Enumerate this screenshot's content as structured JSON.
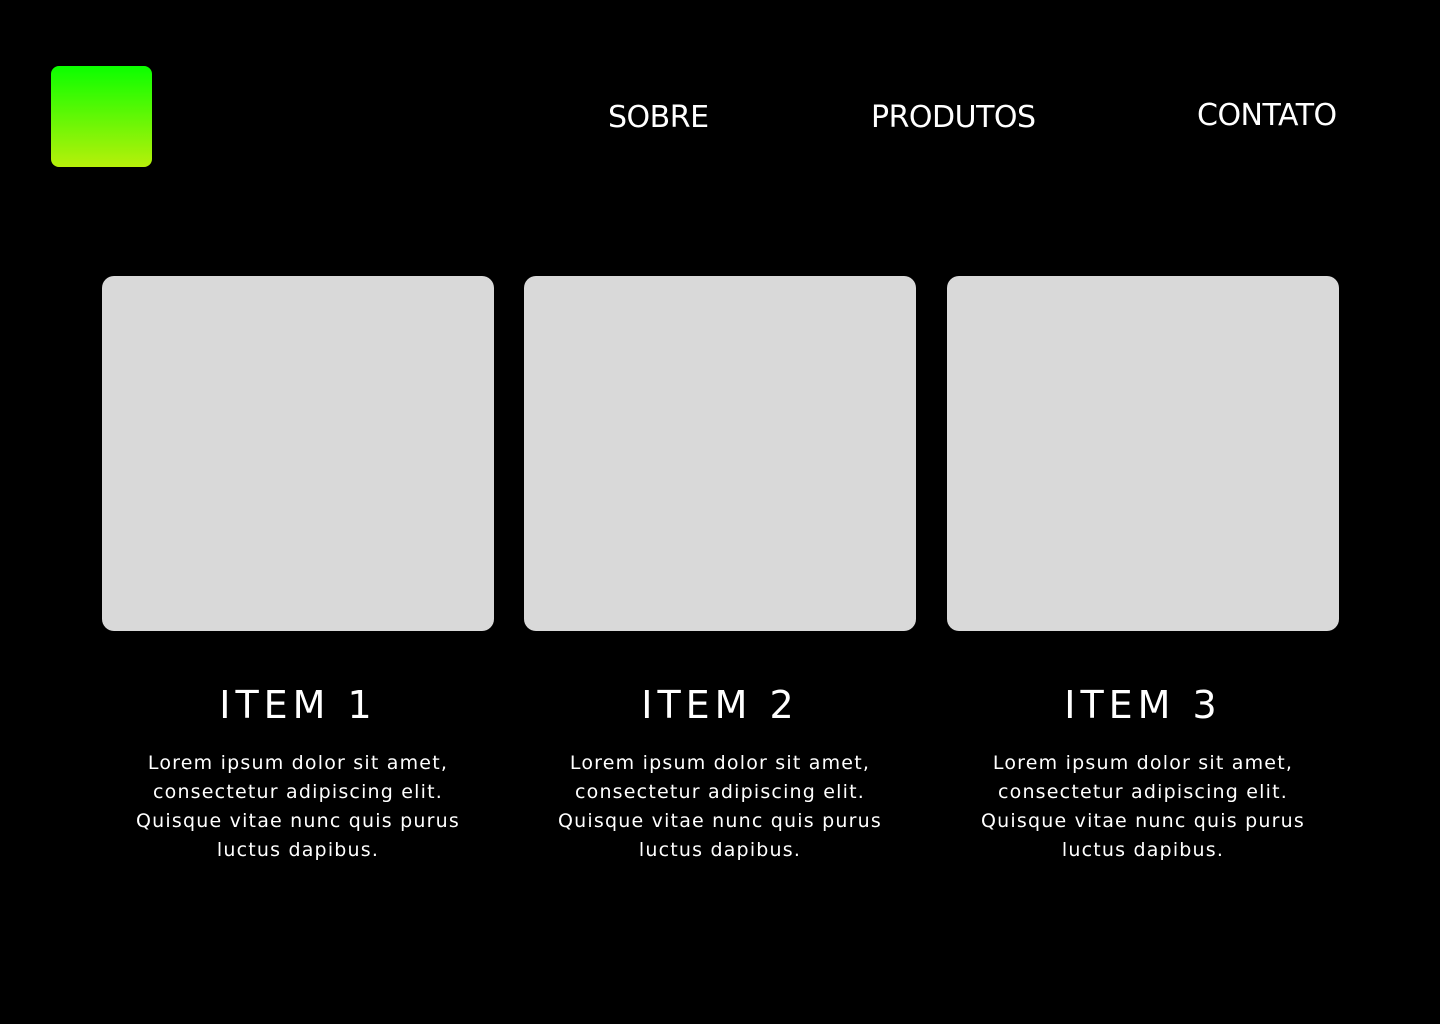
{
  "header": {
    "logo_colors": [
      "#0bff00",
      "#b7f00a"
    ],
    "nav": {
      "sobre": "SOBRE",
      "produtos": "PRODUTOS",
      "contato": "CONTATO"
    }
  },
  "items": [
    {
      "title": "ITEM 1",
      "description": "Lorem ipsum dolor sit amet, consectetur adipiscing elit. Quisque vitae nunc quis purus luctus dapibus."
    },
    {
      "title": "ITEM 2",
      "description": "Lorem ipsum dolor sit amet, consectetur adipiscing elit. Quisque vitae nunc quis purus luctus dapibus."
    },
    {
      "title": "ITEM 3",
      "description": "Lorem ipsum dolor sit amet, consectetur adipiscing elit. Quisque vitae nunc quis purus luctus dapibus."
    }
  ],
  "colors": {
    "background": "#000000",
    "card_placeholder": "#d9d9d9",
    "text": "#ffffff"
  }
}
